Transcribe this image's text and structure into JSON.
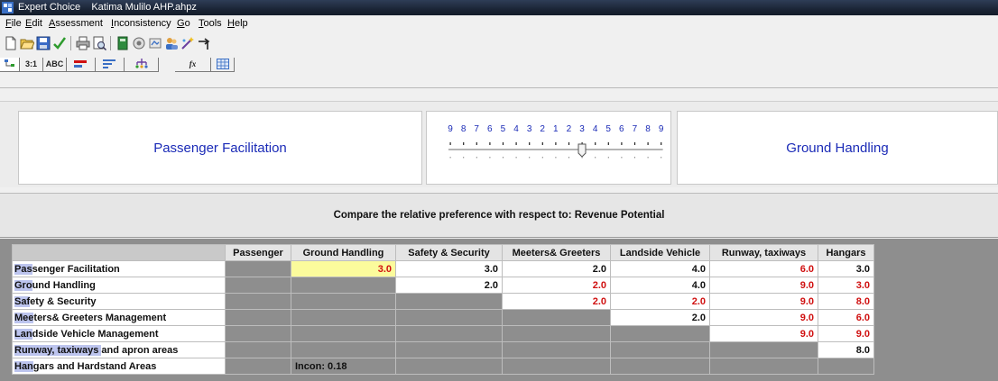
{
  "window": {
    "app_title": "Expert Choice",
    "document_title": "Katima Mulilo AHP.ahpz"
  },
  "menu": [
    {
      "underline": "F",
      "rest": "ile"
    },
    {
      "underline": "E",
      "rest": "dit"
    },
    {
      "underline": "A",
      "rest": "ssessment"
    },
    {
      "underline": "I",
      "rest": "nconsistency"
    },
    {
      "underline": "G",
      "rest": "o"
    },
    {
      "underline": "T",
      "rest": "ools"
    },
    {
      "underline": "H",
      "rest": "elp"
    }
  ],
  "toolbar": [
    "new-icon",
    "open-icon",
    "save-icon",
    "checkmark-icon",
    "print-icon",
    "print-preview-icon",
    "calculator-icon",
    "record-icon",
    "model-icon",
    "users-icon",
    "wizard-icon",
    "jump-icon"
  ],
  "tabs": [
    {
      "label": "",
      "icon": "tree-icon"
    },
    {
      "label": "3:1"
    },
    {
      "label": "ABC"
    },
    {
      "label": "",
      "icon": "verbal-icon"
    },
    {
      "label": "",
      "icon": "graphical-icon"
    },
    {
      "label": "",
      "icon": "hierarchy-icon"
    },
    {
      "label": "fx"
    },
    {
      "label": "",
      "icon": "grid-icon"
    }
  ],
  "comparison": {
    "left_element": "Passenger Facilitation",
    "right_element": "Ground Handling",
    "scale_labels": [
      "9",
      "8",
      "7",
      "6",
      "5",
      "4",
      "3",
      "2",
      "1",
      "2",
      "3",
      "4",
      "5",
      "6",
      "7",
      "8",
      "9"
    ],
    "slider_value": 3.0,
    "slider_favors": "right"
  },
  "prompt": "Compare the relative preference with respect to: Revenue Potential",
  "grid": {
    "columns": [
      "Passenger",
      "Ground Handling",
      "Safety & Security",
      "Meeters& Greeters",
      "Landside Vehicle",
      "Runway, taxiways",
      "Hangars"
    ],
    "rows": [
      {
        "hl": "Pas",
        "rest": "senger Facilitation",
        "cells": [
          null,
          {
            "v": "3.0",
            "c": "red",
            "sel": true
          },
          {
            "v": "3.0",
            "c": "blk"
          },
          {
            "v": "2.0",
            "c": "blk"
          },
          {
            "v": "4.0",
            "c": "blk"
          },
          {
            "v": "6.0",
            "c": "red"
          },
          {
            "v": "3.0",
            "c": "blk"
          }
        ]
      },
      {
        "hl": "Gro",
        "rest": "und Handling",
        "cells": [
          null,
          null,
          {
            "v": "2.0",
            "c": "blk"
          },
          {
            "v": "2.0",
            "c": "red"
          },
          {
            "v": "4.0",
            "c": "blk"
          },
          {
            "v": "9.0",
            "c": "red"
          },
          {
            "v": "3.0",
            "c": "red"
          }
        ]
      },
      {
        "hl": "Saf",
        "rest": "ety & Security",
        "cells": [
          null,
          null,
          null,
          {
            "v": "2.0",
            "c": "red"
          },
          {
            "v": "2.0",
            "c": "red"
          },
          {
            "v": "9.0",
            "c": "red"
          },
          {
            "v": "8.0",
            "c": "red"
          }
        ]
      },
      {
        "hl": "Mee",
        "rest": "ters& Greeters Management",
        "cells": [
          null,
          null,
          null,
          null,
          {
            "v": "2.0",
            "c": "blk"
          },
          {
            "v": "9.0",
            "c": "red"
          },
          {
            "v": "6.0",
            "c": "red"
          }
        ]
      },
      {
        "hl": "Lan",
        "rest": "dside Vehicle Management",
        "cells": [
          null,
          null,
          null,
          null,
          null,
          {
            "v": "9.0",
            "c": "red"
          },
          {
            "v": "9.0",
            "c": "red"
          }
        ]
      },
      {
        "hl": "Runway, taxiways ",
        "rest": "and apron areas",
        "cells": [
          null,
          null,
          null,
          null,
          null,
          null,
          {
            "v": "8.0",
            "c": "blk"
          }
        ]
      },
      {
        "hl": "Han",
        "rest": "gars and Hardstand Areas",
        "cells": [
          null,
          "INCON",
          null,
          null,
          null,
          null,
          null
        ]
      }
    ],
    "inconsistency": "Incon: 0.18"
  },
  "colors": {
    "element_text": "#1b2bb7",
    "inverse_judgment": "#d01010",
    "selected_cell": "#fbfb9c",
    "row_highlight": "#bcc4ee"
  }
}
